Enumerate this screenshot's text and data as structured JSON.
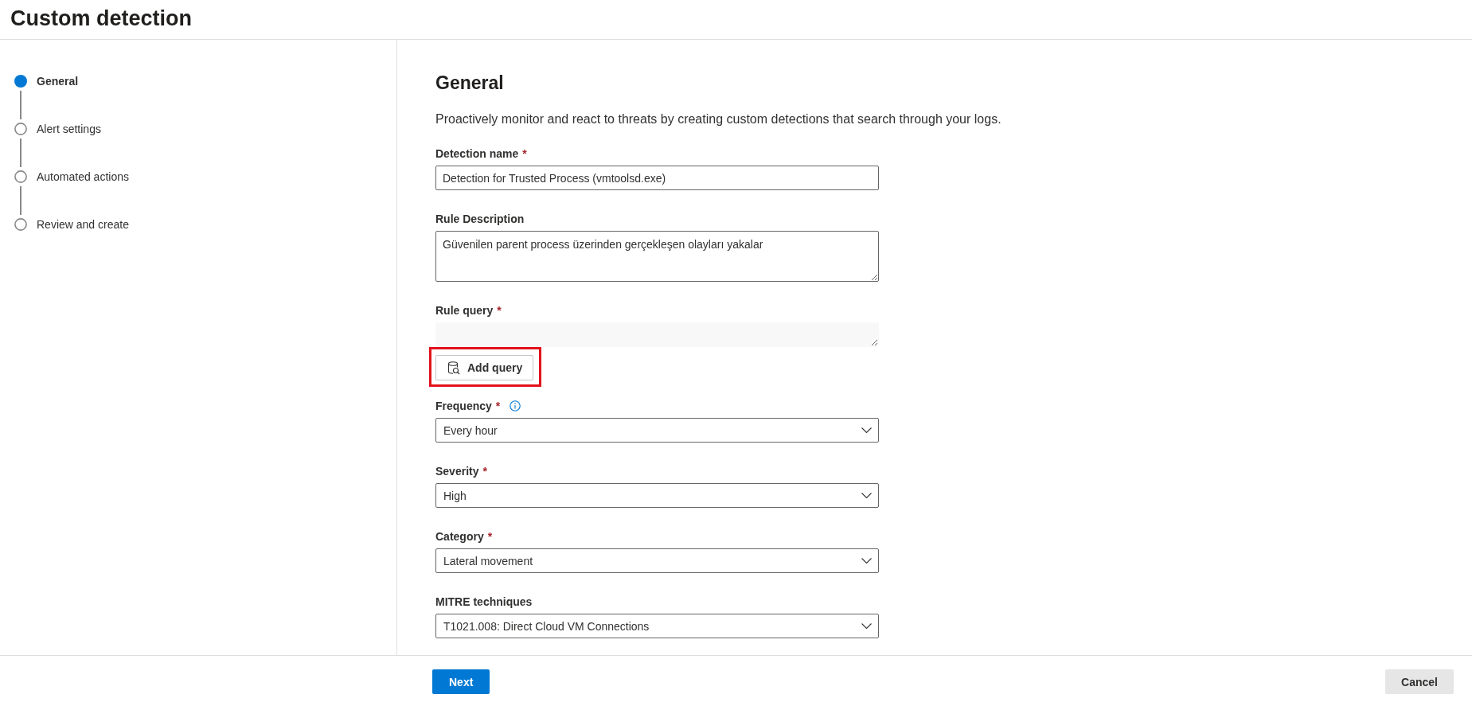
{
  "header": {
    "title": "Custom detection"
  },
  "steps": [
    {
      "label": "General",
      "selected": true
    },
    {
      "label": "Alert settings",
      "selected": false
    },
    {
      "label": "Automated actions",
      "selected": false
    },
    {
      "label": "Review and create",
      "selected": false
    }
  ],
  "form": {
    "heading": "General",
    "description": "Proactively monitor and react to threats by creating custom detections that search through your logs.",
    "fields": [
      {
        "kind": "text",
        "label": "Detection name",
        "required_mark": "*",
        "info": false,
        "value": "Detection for Trusted Process (vmtoolsd.exe)"
      },
      {
        "kind": "textarea",
        "label": "Rule Description",
        "info": false,
        "value": "Güvenilen parent process üzerinden gerçekleşen olayları yakalar"
      },
      {
        "kind": "query",
        "label": "Rule query",
        "required_mark": "*",
        "info": false,
        "disabled": true,
        "button": {
          "label": "Add query",
          "highlighted": true
        }
      },
      {
        "kind": "select",
        "label": "Frequency",
        "required_mark": "*",
        "info": true,
        "value": "Every hour"
      },
      {
        "kind": "select",
        "label": "Severity",
        "required_mark": "*",
        "info": false,
        "value": "High"
      },
      {
        "kind": "select",
        "label": "Category",
        "required_mark": "*",
        "info": false,
        "value": "Lateral movement"
      },
      {
        "kind": "select",
        "label": "MITRE techniques",
        "info": false,
        "value": "T1021.008: Direct Cloud VM Connections"
      }
    ]
  },
  "footer": {
    "buttons": [
      {
        "label": "Next",
        "kind": "primary"
      },
      {
        "label": "Cancel",
        "kind": "secondary"
      }
    ]
  }
}
